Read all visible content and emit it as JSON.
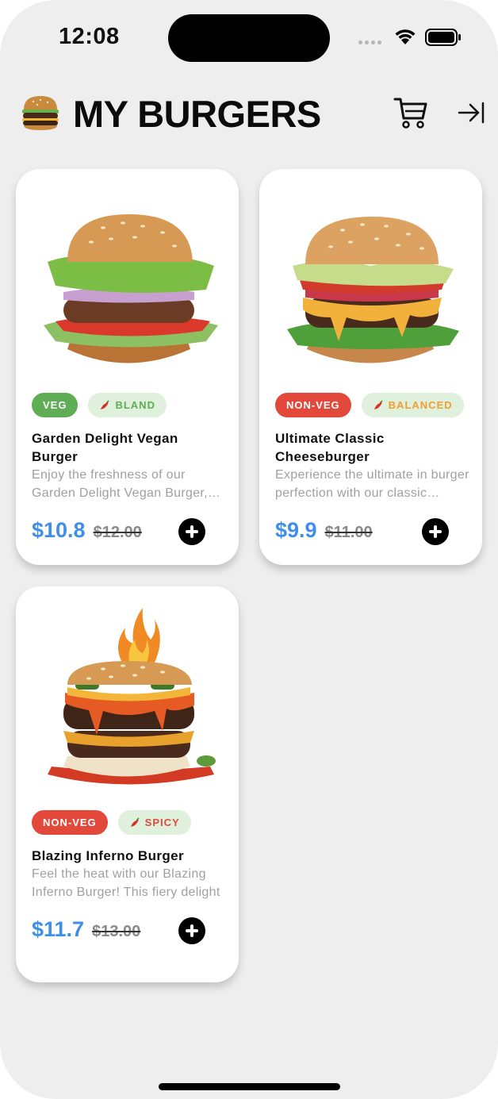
{
  "status_bar": {
    "time": "12:08"
  },
  "header": {
    "title": "MY BURGERS"
  },
  "icons": {
    "logo": "burger-logo-icon",
    "cart": "cart-icon",
    "exit": "logout-arrow-icon",
    "add": "plus-icon",
    "chili": "chili-pepper-icon"
  },
  "colors": {
    "price": "#3f8fe8",
    "veg_tag": "#5fae55",
    "nonveg_tag": "#e2493b",
    "bland_text": "#5fae55",
    "balanced_text": "#f0a030",
    "spicy_text": "#e2493b",
    "spice_tag_bg": "#dff0dc"
  },
  "products": [
    {
      "diet": "VEG",
      "spice": "BLAND",
      "name": "Garden Delight Vegan Burger",
      "description": "Enjoy the freshness of our Garden Delight Vegan Burger, packed with crisp vegetables",
      "price": "$10.8",
      "old_price": "$12.00"
    },
    {
      "diet": "NON-VEG",
      "spice": "BALANCED",
      "name": "Ultimate Classic Cheeseburger",
      "description": "Experience the ultimate in burger perfection with our classic cheeseburger",
      "price": "$9.9",
      "old_price": "$11.00"
    },
    {
      "diet": "NON-VEG",
      "spice": "SPICY",
      "name": "Blazing Inferno Burger",
      "description": "Feel the heat with our Blazing Inferno Burger! This fiery delight",
      "price": "$11.7",
      "old_price": "$13.00"
    }
  ]
}
